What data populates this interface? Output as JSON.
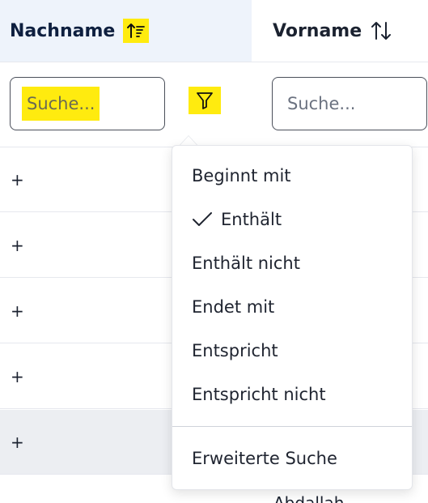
{
  "columns": {
    "nachname": {
      "label": "Nachname",
      "sort_icon": "sort-ascending-icon",
      "highlighted": true
    },
    "vorname": {
      "label": "Vorname",
      "sort_icon": "sort-both-icon"
    }
  },
  "filters": {
    "nachname_placeholder": "Suche...",
    "vorname_placeholder": "Suche...",
    "filter_icon": "filter-icon"
  },
  "rows": [
    {
      "expand": "+"
    },
    {
      "expand": "+"
    },
    {
      "expand": "+"
    },
    {
      "expand": "+"
    },
    {
      "expand": "+"
    }
  ],
  "partial_cell_text": "Abdallah",
  "filter_menu": {
    "items": [
      {
        "label": "Beginnt mit",
        "checked": false
      },
      {
        "label": "Enthält",
        "checked": true
      },
      {
        "label": "Enthält nicht",
        "checked": false
      },
      {
        "label": "Endet mit",
        "checked": false
      },
      {
        "label": "Entspricht",
        "checked": false
      },
      {
        "label": "Entspricht nicht",
        "checked": false
      }
    ],
    "advanced": "Erweiterte Suche"
  },
  "colors": {
    "highlight": "#ffeb0f",
    "header_bg": "#eef3fb",
    "row_shaded": "#eceef2",
    "header_text": "#0e1f3f"
  }
}
